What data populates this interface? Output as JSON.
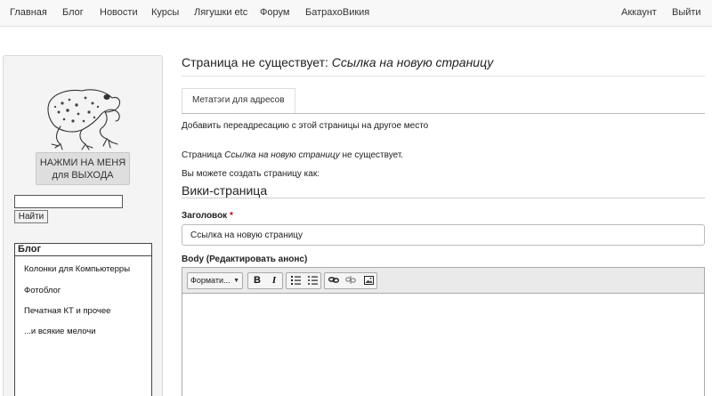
{
  "topnav": {
    "items": [
      "Главная",
      "Блог",
      "Новости",
      "Курсы",
      "Лягушки etc",
      "Форум",
      "БатрахоВикия"
    ],
    "account": "Аккаунт",
    "logout": "Выйти"
  },
  "sidebar": {
    "exit_button_line1": "НАЖМИ НА МЕНЯ",
    "exit_button_line2": "для ВЫХОДА",
    "search_value": "",
    "search_button": "Найти",
    "blog": {
      "title": "Блог",
      "links": [
        "Колонки для Компьютерры",
        "Фотоблог",
        "Печатная КТ и прочее",
        "...и всякие мелочи"
      ]
    }
  },
  "main": {
    "title_prefix": "Страница не существует: ",
    "title_link": "Ссылка на новую страницу",
    "tab": "Метатэги для адресов",
    "redirect_text": "Добавить переадресацию с этой страницы на другое место",
    "notexist_prefix": "Страница ",
    "notexist_link": "Ссылка на новую страницу",
    "notexist_suffix": " не существует.",
    "create_as": "Вы можете создать страницу как:",
    "section_heading": "Вики-страница",
    "title_label": "Заголовок",
    "required_mark": "*",
    "title_value": "Ссылка на новую страницу",
    "body_label": "Body (Редактировать анонс)",
    "editor": {
      "format_label": "Формати...",
      "bold": "B",
      "italic": "I"
    }
  },
  "icons": [
    "frog-logo",
    "bold-icon",
    "italic-icon",
    "numbered-list-icon",
    "bullet-list-icon",
    "link-icon",
    "unlink-icon",
    "image-icon",
    "dropdown-caret-icon"
  ]
}
